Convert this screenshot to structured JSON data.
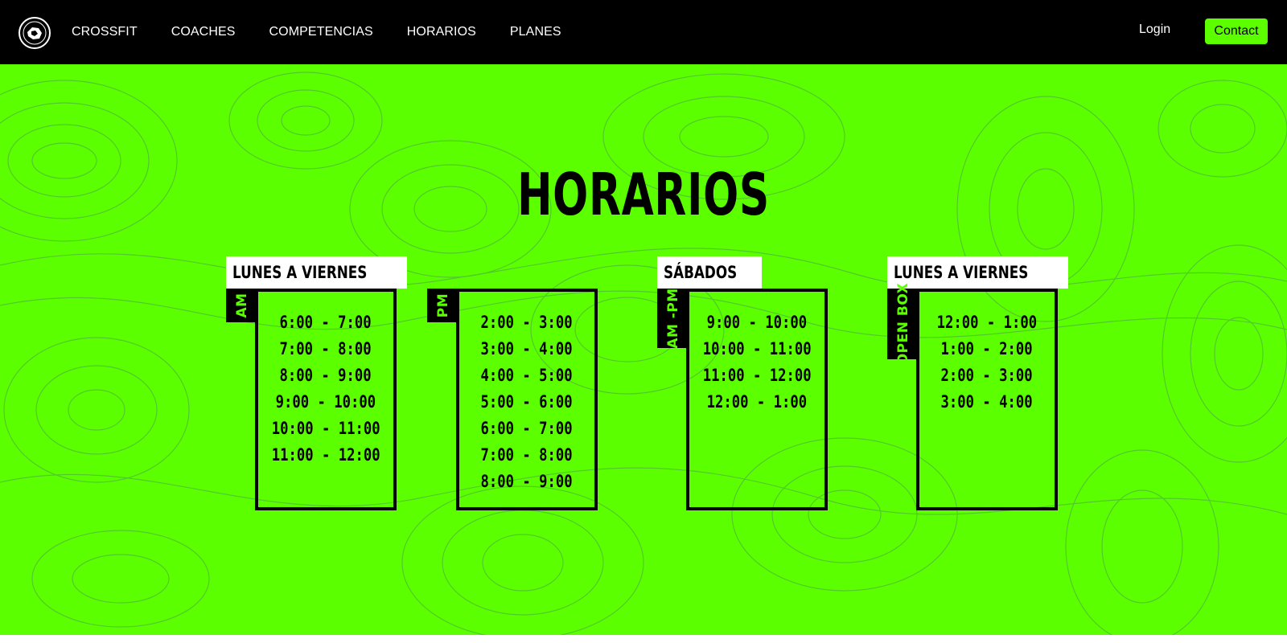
{
  "nav": {
    "logo_icon": "gym-emblem-icon",
    "links": [
      "CROSSFIT",
      "COACHES",
      "COMPETENCIAS",
      "HORARIOS",
      "PLANES"
    ],
    "login": "Login",
    "contact": "Contact"
  },
  "colors": {
    "accent": "#5cff00",
    "nav_bg": "#000000"
  },
  "page": {
    "title": "HORARIOS"
  },
  "schedules": [
    {
      "day": "LUNES A VIERNES",
      "tab": "AM",
      "times": [
        "6:00 - 7:00",
        "7:00 - 8:00",
        "8:00 - 9:00",
        "9:00 - 10:00",
        "10:00 - 11:00",
        "11:00 - 12:00"
      ]
    },
    {
      "day": "",
      "tab": "PM",
      "times": [
        "2:00 - 3:00",
        "3:00 - 4:00",
        "4:00 - 5:00",
        "5:00 - 6:00",
        "6:00 - 7:00",
        "7:00 - 8:00",
        "8:00 - 9:00"
      ]
    },
    {
      "day": "SÁBADOS",
      "tab": "AM -PM",
      "times": [
        "9:00 - 10:00",
        "10:00 - 11:00",
        "11:00 - 12:00",
        "12:00 - 1:00"
      ]
    },
    {
      "day": "LUNES A VIERNES",
      "tab": "OPEN BOX",
      "times": [
        "12:00 - 1:00",
        "1:00 - 2:00",
        "2:00 - 3:00",
        "3:00 - 4:00"
      ]
    }
  ]
}
